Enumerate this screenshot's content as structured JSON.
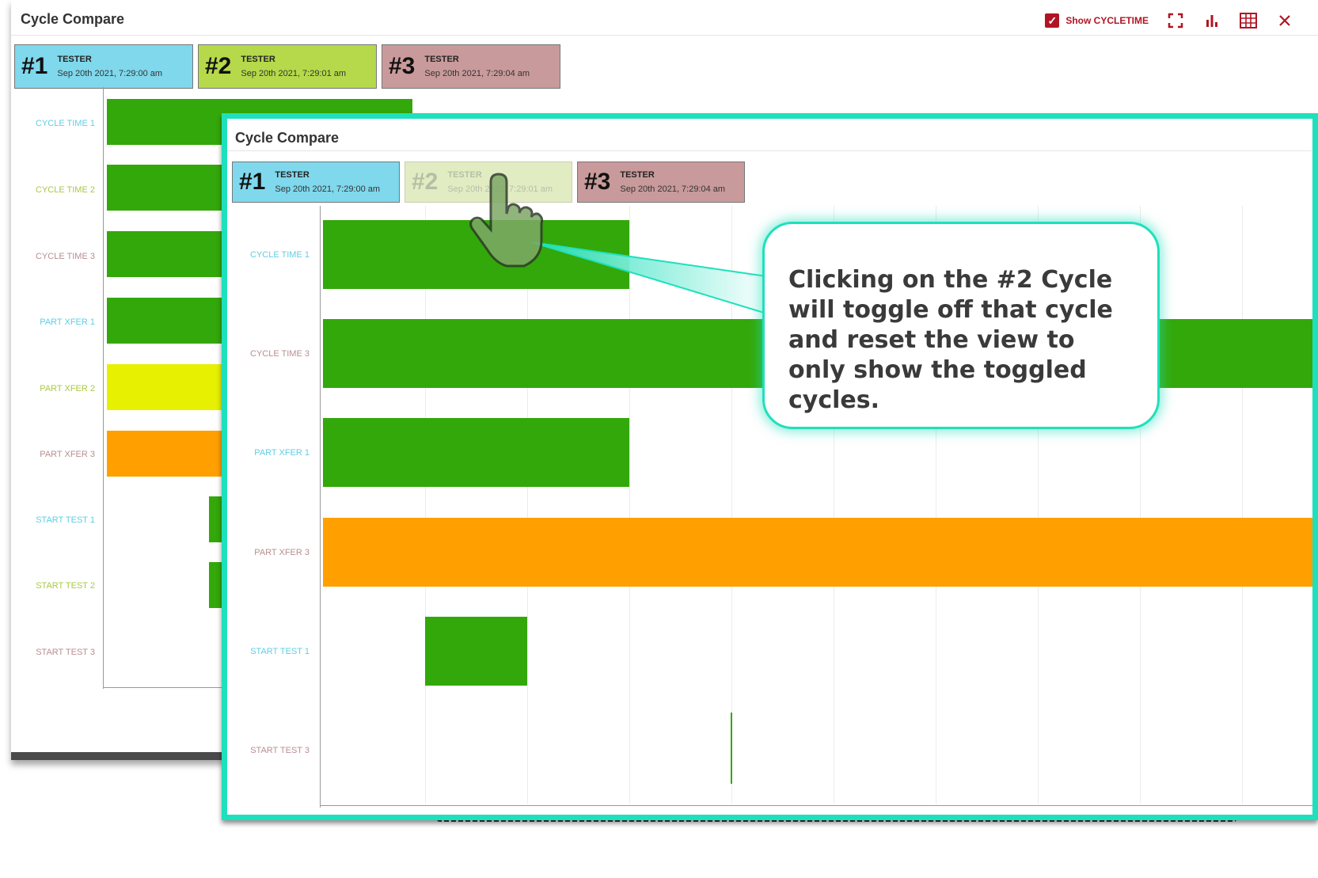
{
  "back": {
    "title": "Cycle Compare",
    "show_label": "Show CYCLETIME",
    "tabs": [
      {
        "num": "#1",
        "user": "TESTER",
        "date": "Sep 20th 2021, 7:29:00 am"
      },
      {
        "num": "#2",
        "user": "TESTER",
        "date": "Sep 20th 2021, 7:29:01 am"
      },
      {
        "num": "#3",
        "user": "TESTER",
        "date": "Sep 20th 2021, 7:29:04 am"
      }
    ],
    "rows": [
      "CYCLE TIME 1",
      "CYCLE TIME 2",
      "CYCLE TIME 3",
      "PART XFER 1",
      "PART XFER 2",
      "PART XFER 3",
      "START TEST 1",
      "START TEST 2",
      "START TEST 3"
    ]
  },
  "front": {
    "title": "Cycle Compare",
    "tabs": [
      {
        "num": "#1",
        "user": "TESTER",
        "date": "Sep 20th 2021, 7:29:00 am",
        "active": true
      },
      {
        "num": "#2",
        "user": "TESTER",
        "date": "Sep 20th 2021, 7:29:01 am",
        "active": false
      },
      {
        "num": "#3",
        "user": "TESTER",
        "date": "Sep 20th 2021, 7:29:04 am",
        "active": true
      }
    ],
    "rows": [
      "CYCLE TIME 1",
      "CYCLE TIME 3",
      "PART XFER 1",
      "PART XFER 3",
      "START TEST 1",
      "START TEST 3"
    ]
  },
  "callout": {
    "text": "Clicking on the #2 Cycle will toggle off that cycle and reset the view to only show the toggled cycles."
  },
  "icons": {
    "checkbox": "checkbox-checked-icon",
    "fullscreen": "fullscreen-icon",
    "chart": "bar-chart-icon",
    "table": "table-icon",
    "close": "close-icon",
    "pointer": "hand-pointer-icon"
  },
  "colors": {
    "accent": "#b01525",
    "highlight": "#1fe0bc",
    "cycle1": "#7fd8ec",
    "cycle2": "#b5d94a",
    "cycle3": "#c99a9b",
    "bar_green": "#33a80a",
    "bar_yellow": "#e6f000",
    "bar_orange": "#ffa000"
  }
}
